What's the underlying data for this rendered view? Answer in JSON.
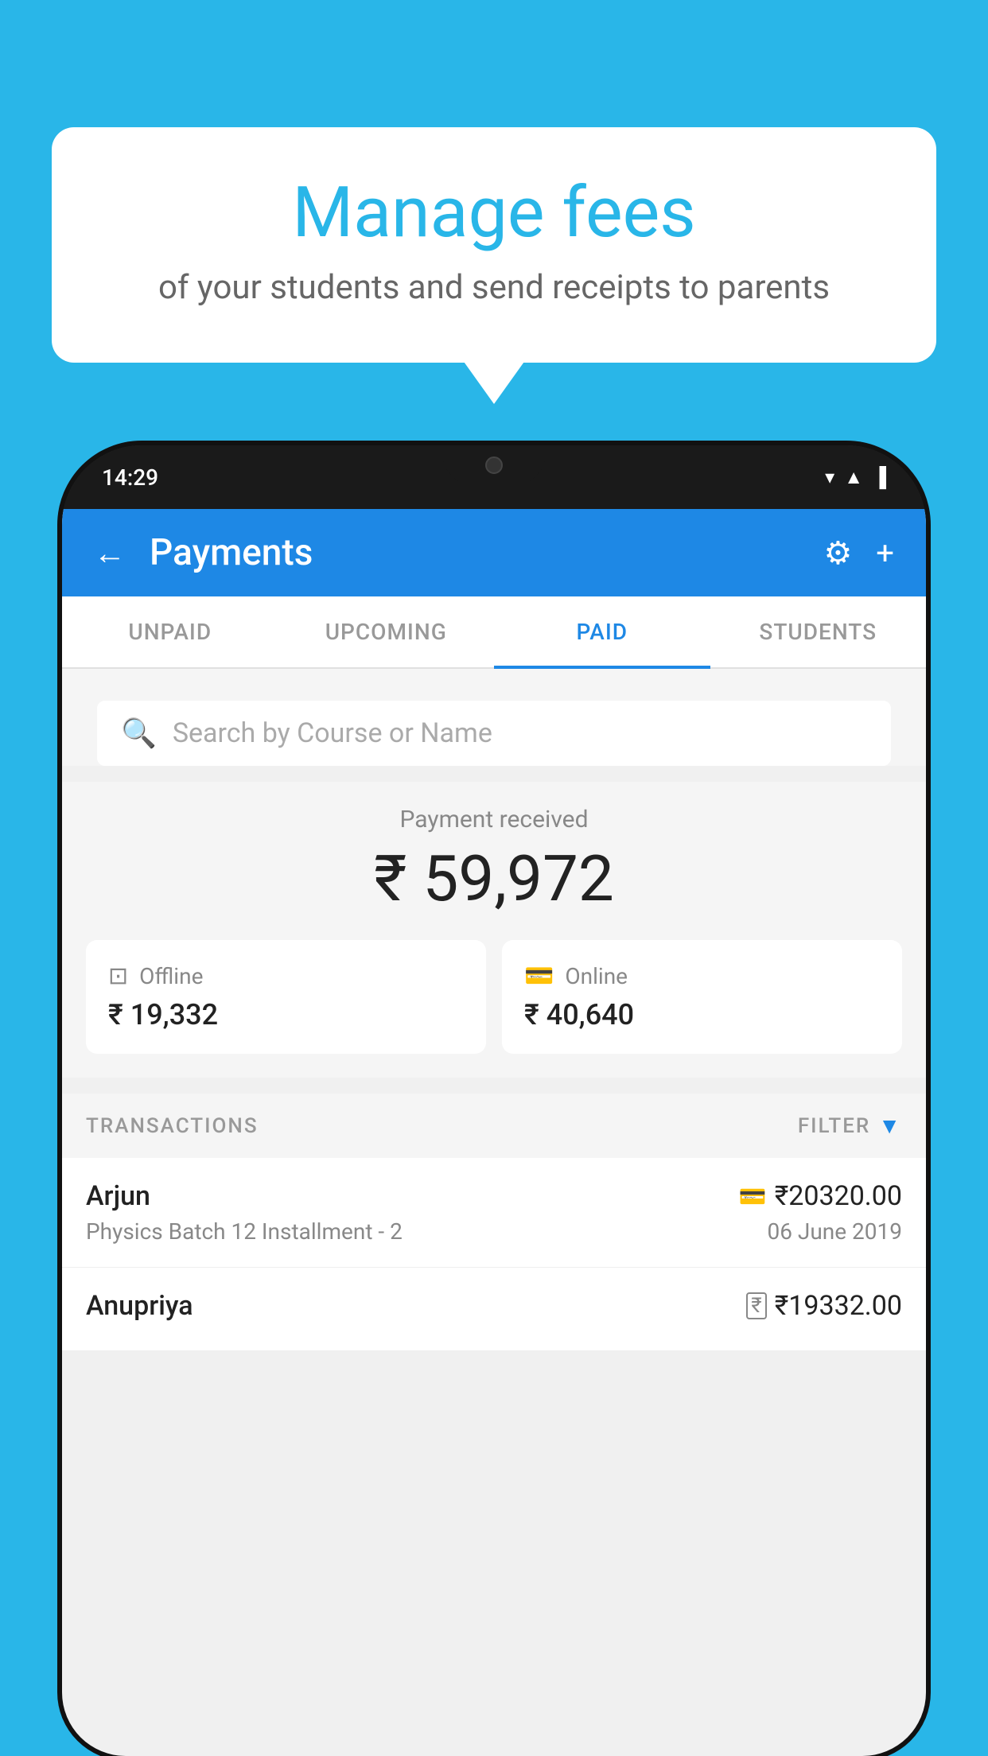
{
  "page": {
    "bg_color": "#29b6e8"
  },
  "speech_bubble": {
    "title": "Manage fees",
    "subtitle": "of your students and send receipts to parents"
  },
  "status_bar": {
    "time": "14:29",
    "icons": [
      "wifi",
      "signal",
      "battery"
    ]
  },
  "header": {
    "title": "Payments",
    "back_label": "←",
    "settings_label": "⚙",
    "add_label": "+"
  },
  "tabs": [
    {
      "label": "UNPAID",
      "active": false
    },
    {
      "label": "UPCOMING",
      "active": false
    },
    {
      "label": "PAID",
      "active": true
    },
    {
      "label": "STUDENTS",
      "active": false
    }
  ],
  "search": {
    "placeholder": "Search by Course or Name"
  },
  "payment_summary": {
    "label": "Payment received",
    "total": "₹ 59,972",
    "offline": {
      "label": "Offline",
      "amount": "₹ 19,332"
    },
    "online": {
      "label": "Online",
      "amount": "₹ 40,640"
    }
  },
  "transactions_section": {
    "label": "TRANSACTIONS",
    "filter_label": "FILTER"
  },
  "transactions": [
    {
      "name": "Arjun",
      "course": "Physics Batch 12 Installment - 2",
      "amount": "₹20320.00",
      "date": "06 June 2019",
      "payment_type": "card"
    },
    {
      "name": "Anupriya",
      "course": "",
      "amount": "₹19332.00",
      "date": "",
      "payment_type": "rupee"
    }
  ]
}
